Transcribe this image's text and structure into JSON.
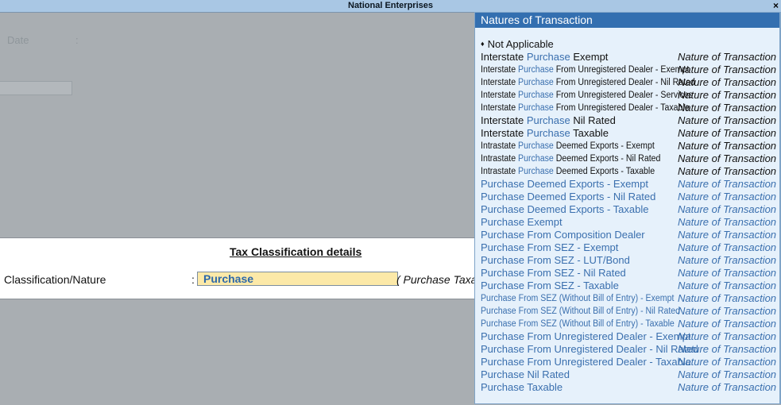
{
  "window": {
    "title": "National Enterprises",
    "close_glyph": "×"
  },
  "background_form": {
    "date_label": "Date",
    "date_colon": ":"
  },
  "tax_panel": {
    "heading": "Tax Classification details",
    "field_label": "Classification/Nature",
    "colon": ":",
    "field_value": "Purchase",
    "hint_text": "( Purchase Taxable"
  },
  "popup": {
    "title": "Natures of Transaction",
    "bullet": "♦",
    "items": [
      {
        "parts": [
          "Not Applicable"
        ],
        "nature": "",
        "bulleted": true
      },
      {
        "parts": [
          "Interstate ",
          "Purchase",
          " Exempt"
        ],
        "nature": "Nature of Transaction"
      },
      {
        "parts": [
          "Interstate ",
          "Purchase",
          " From Unregistered Dealer - Exempt"
        ],
        "nature": "Nature of Transaction",
        "narrow": true
      },
      {
        "parts": [
          "Interstate ",
          "Purchase",
          " From Unregistered Dealer - Nil Rated"
        ],
        "nature": "Nature of Transaction",
        "narrow": true
      },
      {
        "parts": [
          "Interstate ",
          "Purchase",
          " From Unregistered Dealer - Services"
        ],
        "nature": "Nature of Transaction",
        "narrow": true
      },
      {
        "parts": [
          "Interstate ",
          "Purchase",
          " From Unregistered Dealer - Taxable"
        ],
        "nature": "Nature of Transaction",
        "narrow": true
      },
      {
        "parts": [
          "Interstate ",
          "Purchase",
          " Nil Rated"
        ],
        "nature": "Nature of Transaction"
      },
      {
        "parts": [
          "Interstate ",
          "Purchase",
          " Taxable"
        ],
        "nature": "Nature of Transaction"
      },
      {
        "parts": [
          "Intrastate ",
          "Purchase",
          " Deemed Exports - Exempt"
        ],
        "nature": "Nature of Transaction",
        "narrow": true
      },
      {
        "parts": [
          "Intrastate ",
          "Purchase",
          " Deemed Exports - Nil Rated"
        ],
        "nature": "Nature of Transaction",
        "narrow": true
      },
      {
        "parts": [
          "Intrastate ",
          "Purchase",
          " Deemed Exports - Taxable"
        ],
        "nature": "Nature of Transaction",
        "narrow": true
      },
      {
        "parts": [
          "Purchase Deemed Exports - Exempt"
        ],
        "nature": "Nature of Transaction",
        "blue": true
      },
      {
        "parts": [
          "Purchase Deemed Exports - Nil Rated"
        ],
        "nature": "Nature of Transaction",
        "blue": true
      },
      {
        "parts": [
          "Purchase Deemed Exports - Taxable"
        ],
        "nature": "Nature of Transaction",
        "blue": true
      },
      {
        "parts": [
          "Purchase Exempt"
        ],
        "nature": "Nature of Transaction",
        "blue": true
      },
      {
        "parts": [
          "Purchase From Composition Dealer"
        ],
        "nature": "Nature of Transaction",
        "blue": true
      },
      {
        "parts": [
          "Purchase From SEZ - Exempt"
        ],
        "nature": "Nature of Transaction",
        "blue": true
      },
      {
        "parts": [
          "Purchase From SEZ - LUT/Bond"
        ],
        "nature": "Nature of Transaction",
        "blue": true
      },
      {
        "parts": [
          "Purchase From SEZ - Nil Rated"
        ],
        "nature": "Nature of Transaction",
        "blue": true
      },
      {
        "parts": [
          "Purchase From SEZ - Taxable"
        ],
        "nature": "Nature of Transaction",
        "blue": true
      },
      {
        "parts": [
          "Purchase From SEZ (Without Bill of Entry) - Exempt"
        ],
        "nature": "Nature of Transaction",
        "blue": true,
        "narrow": true
      },
      {
        "parts": [
          "Purchase From SEZ (Without Bill of Entry) - Nil Rated"
        ],
        "nature": "Nature of Transaction",
        "blue": true,
        "narrow": true
      },
      {
        "parts": [
          "Purchase From SEZ (Without Bill of Entry) - Taxable"
        ],
        "nature": "Nature of Transaction",
        "blue": true,
        "narrow": true
      },
      {
        "parts": [
          "Purchase From Unregistered Dealer - Exempt"
        ],
        "nature": "Nature of Transaction",
        "blue": true
      },
      {
        "parts": [
          "Purchase From Unregistered Dealer - Nil Rated"
        ],
        "nature": "Nature of Transaction",
        "blue": true
      },
      {
        "parts": [
          "Purchase From Unregistered Dealer - Taxable"
        ],
        "nature": "Nature of Transaction",
        "blue": true
      },
      {
        "parts": [
          "Purchase Nil Rated"
        ],
        "nature": "Nature of Transaction",
        "blue": true
      },
      {
        "parts": [
          "Purchase Taxable"
        ],
        "nature": "Nature of Transaction",
        "blue": true
      }
    ]
  },
  "colors": {
    "accent": "#336fb0",
    "link_blue": "#3a6fae",
    "highlight_input": "#fce9a8",
    "background": "#a9aeb2"
  }
}
